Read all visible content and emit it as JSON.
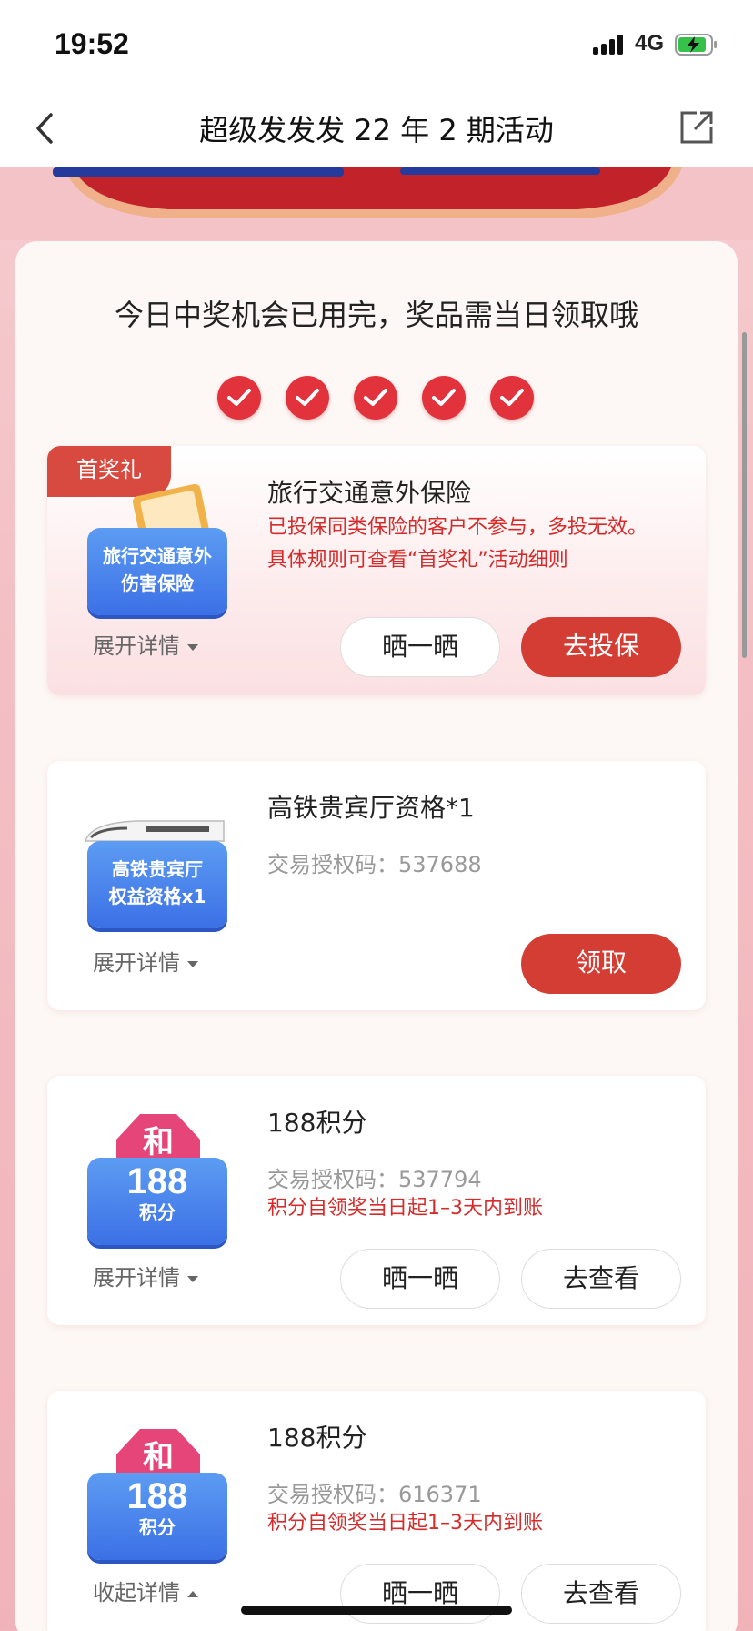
{
  "status_bar": {
    "time": "19:52",
    "network": "4G"
  },
  "nav": {
    "title": "超级发发发 22 年 2 期活动"
  },
  "headline": "今日中奖机会已用完，奖品需当日领取哦",
  "checks_count": 5,
  "cards": [
    {
      "ribbon": "首奖礼",
      "thumb_line1": "旅行交通意外",
      "thumb_line2": "伤害保险",
      "title": "旅行交通意外保险",
      "red_note": "已投保同类保险的客户不参与，多投无效。具体规则可查看“首奖礼”活动细则",
      "toggle": "展开详情",
      "btn_share": "晒一晒",
      "btn_action": "去投保"
    },
    {
      "thumb_line1": "高铁贵宾厅",
      "thumb_line2": "权益资格x1",
      "title": "高铁贵宾厅资格*1",
      "code_label": "交易授权码：",
      "code": "537688",
      "toggle": "展开详情",
      "btn_action": "领取"
    },
    {
      "badge": "和",
      "thumb_num": "188",
      "thumb_unit": "积分",
      "title": "188积分",
      "code_label": "交易授权码：",
      "code": "537794",
      "red_note": "积分自领奖当日起1–3天内到账",
      "toggle": "展开详情",
      "btn_share": "晒一晒",
      "btn_action": "去查看"
    },
    {
      "badge": "和",
      "thumb_num": "188",
      "thumb_unit": "积分",
      "title": "188积分",
      "code_label": "交易授权码：",
      "code": "616371",
      "red_note": "积分自领奖当日起1–3天内到账",
      "toggle": "收起详情",
      "btn_share": "晒一晒",
      "btn_action": "去查看"
    }
  ],
  "colors": {
    "accent": "#d33d34",
    "check": "#e2333d",
    "thumb_blue": "#4a86ee"
  }
}
